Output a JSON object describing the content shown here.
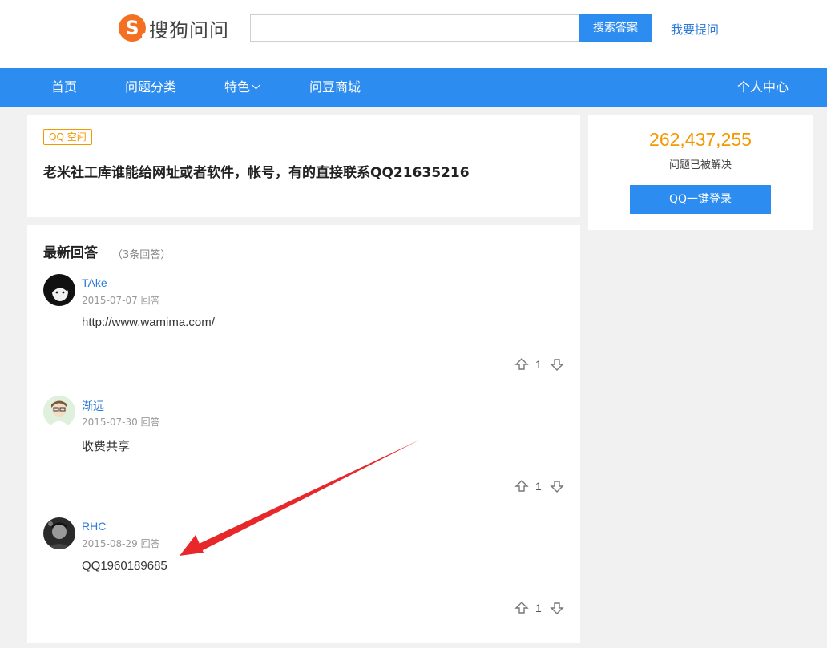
{
  "header": {
    "logo_text": "搜狗问问",
    "search": {
      "value": "",
      "placeholder": ""
    },
    "search_button": "搜索答案",
    "ask_link": "我要提问"
  },
  "nav": {
    "items": [
      "首页",
      "问题分类",
      "特色",
      "问豆商城"
    ],
    "right": "个人中心"
  },
  "question": {
    "tag": "QQ 空间",
    "title": "老米社工库谁能给网址或者软件，帐号，有的直接联系QQ21635216"
  },
  "side": {
    "count": "262,437,255",
    "caption": "问题已被解决",
    "login_button": "QQ一键登录"
  },
  "answers_section": {
    "heading": "最新回答",
    "count": "（3条回答）",
    "items": [
      {
        "name": "TAke",
        "date": "2015-07-07",
        "action": "回答",
        "body": "http://www.wamima.com/",
        "votes": "1"
      },
      {
        "name": "渐远",
        "date": "2015-07-30",
        "action": "回答",
        "body": "收费共享",
        "votes": "1"
      },
      {
        "name": "RHC",
        "date": "2015-08-29",
        "action": "回答",
        "body": "QQ1960189685",
        "votes": "1"
      }
    ]
  },
  "colors": {
    "brand_blue": "#2d8cf0",
    "accent_orange": "#f39800",
    "annotation_red": "#e8272b"
  }
}
